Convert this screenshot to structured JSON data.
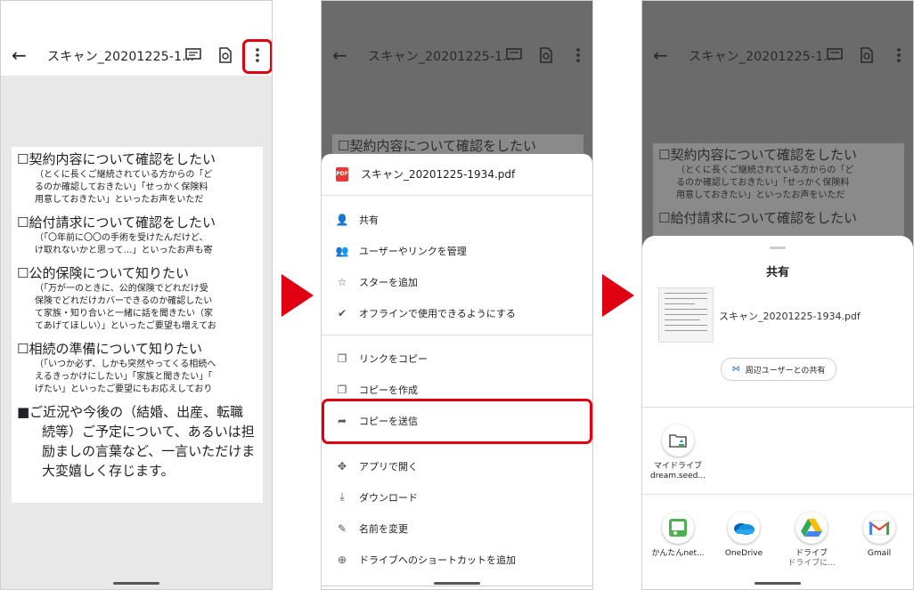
{
  "screen1": {
    "title": "スキャン_20201225-1...",
    "doc_lines": [
      {
        "kind": "h",
        "text": "☐契約内容について確認をしたい"
      },
      {
        "kind": "l",
        "text": "（とくに長くご継続されている方からの「ど"
      },
      {
        "kind": "l",
        "text": "るのか確認しておきたい」「せっかく保険料"
      },
      {
        "kind": "l",
        "text": "用意しておきたい」といったお声をいただ"
      },
      {
        "kind": "h",
        "text": "☐給付請求について確認をしたい"
      },
      {
        "kind": "l",
        "text": "（「〇年前に〇〇の手術を受けたんだけど、"
      },
      {
        "kind": "l",
        "text": "け取れないかと思って…」といったお声も寄"
      },
      {
        "kind": "h",
        "text": "☐公的保険について知りたい"
      },
      {
        "kind": "l",
        "text": "（「万が一のときに、公的保険でどれだけ受"
      },
      {
        "kind": "l",
        "text": "保険でどれだけカバーできるのか確認したい"
      },
      {
        "kind": "l",
        "text": "て家族・知り合いと一緒に話を聞きたい（家"
      },
      {
        "kind": "l",
        "text": "てあげてほしい）」といったご要望も増えてお"
      },
      {
        "kind": "h",
        "text": "☐相続の準備について知りたい"
      },
      {
        "kind": "l",
        "text": "（「いつか必ず、しかも突然やってくる相続へ"
      },
      {
        "kind": "l",
        "text": "えるきっかけにしたい」「家族と聞きたい」「"
      },
      {
        "kind": "l",
        "text": "げたい」といったご要望にもお応えしており"
      },
      {
        "kind": "h",
        "text": "■ご近況や今後の（結婚、出産、転職"
      },
      {
        "kind": "h2",
        "text": "続等）ご予定について、あるいは担"
      },
      {
        "kind": "h2",
        "text": "励ましの言葉など、一言いただけま"
      },
      {
        "kind": "h2",
        "text": "大変嬉しく存じます。"
      }
    ]
  },
  "screen2": {
    "title": "スキャン_20201225-1...",
    "pdf_badge": "PDF",
    "filename": "スキャン_20201225-1934.pdf",
    "dim_lines": [
      {
        "kind": "h",
        "text": "☐契約内容について確認をしたい"
      }
    ],
    "menu": [
      {
        "icon": "person-add-icon",
        "glyph": "👤",
        "label": "共有"
      },
      {
        "icon": "manage-users-icon",
        "glyph": "👥",
        "label": "ユーザーやリンクを管理"
      },
      {
        "icon": "star-icon",
        "glyph": "☆",
        "label": "スターを追加"
      },
      {
        "icon": "offline-icon",
        "glyph": "✔",
        "label": "オフラインで使用できるようにする"
      },
      {
        "icon": "copy-link-icon",
        "glyph": "❐",
        "label": "リンクをコピー"
      },
      {
        "icon": "make-copy-icon",
        "glyph": "❐",
        "label": "コピーを作成"
      },
      {
        "icon": "send-copy-icon",
        "glyph": "➦",
        "label": "コピーを送信"
      },
      {
        "icon": "open-with-icon",
        "glyph": "✥",
        "label": "アプリで開く"
      },
      {
        "icon": "download-icon",
        "glyph": "⤓",
        "label": "ダウンロード"
      },
      {
        "icon": "rename-icon",
        "glyph": "✎",
        "label": "名前を変更"
      },
      {
        "icon": "add-shortcut-icon",
        "glyph": "⊕",
        "label": "ドライブへのショートカットを追加"
      }
    ]
  },
  "screen3": {
    "title": "スキャン_20201225-1...",
    "dim_lines": [
      {
        "kind": "h",
        "text": "☐契約内容について確認をしたい"
      },
      {
        "kind": "l",
        "text": "（とくに長くご継続されている方からの「ど"
      },
      {
        "kind": "l",
        "text": "るのか確認しておきたい」「せっかく保険料"
      },
      {
        "kind": "l",
        "text": "用意しておきたい」といったお声をいただ"
      },
      {
        "kind": "h",
        "text": "☐給付請求について確認をしたい"
      }
    ],
    "share_title": "共有",
    "filename": "スキャン_20201225-1934.pdf",
    "nearby_label": "周辺ユーザーとの共有",
    "direct_target": {
      "line1": "マイドライブ",
      "line2": "dream.seed..."
    },
    "apps": [
      {
        "icon": "kantan-net-icon",
        "label": "かんたんnet...",
        "sub": ""
      },
      {
        "icon": "onedrive-icon",
        "label": "OneDrive",
        "sub": ""
      },
      {
        "icon": "google-drive-icon",
        "label": "ドライブ",
        "sub": "ドライブに..."
      },
      {
        "icon": "gmail-icon",
        "label": "Gmail",
        "sub": ""
      }
    ]
  },
  "colors": {
    "highlight": "#e00012",
    "accent": "#1a73e8"
  }
}
